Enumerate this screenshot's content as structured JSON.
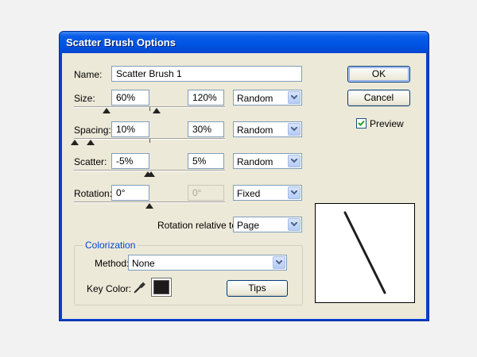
{
  "window": {
    "title": "Scatter Brush Options"
  },
  "name": {
    "label": "Name:",
    "value": "Scatter Brush 1"
  },
  "size": {
    "label": "Size:",
    "min": "60%",
    "max": "120%",
    "mode": "Random"
  },
  "spacing": {
    "label": "Spacing:",
    "min": "10%",
    "max": "30%",
    "mode": "Random"
  },
  "scatter": {
    "label": "Scatter:",
    "min": "-5%",
    "max": "5%",
    "mode": "Random"
  },
  "rotation": {
    "label": "Rotation:",
    "min": "0°",
    "max": "0°",
    "mode": "Fixed"
  },
  "rotation_relative": {
    "label": "Rotation relative to:",
    "value": "Page"
  },
  "colorization": {
    "title": "Colorization",
    "method_label": "Method:",
    "method_value": "None",
    "key_color_label": "Key Color:",
    "key_color": "#1e1a1c",
    "tips_label": "Tips"
  },
  "buttons": {
    "ok": "OK",
    "cancel": "Cancel"
  },
  "preview": {
    "label": "Preview",
    "checked": true
  },
  "icons": {
    "eyedropper": "eyedropper-icon",
    "dropdown": "chevron-down-icon",
    "check": "check-icon"
  },
  "colors": {
    "title_bar": "#0054e3",
    "dialog_bg": "#ece9d8",
    "group_title": "#0046d5"
  }
}
